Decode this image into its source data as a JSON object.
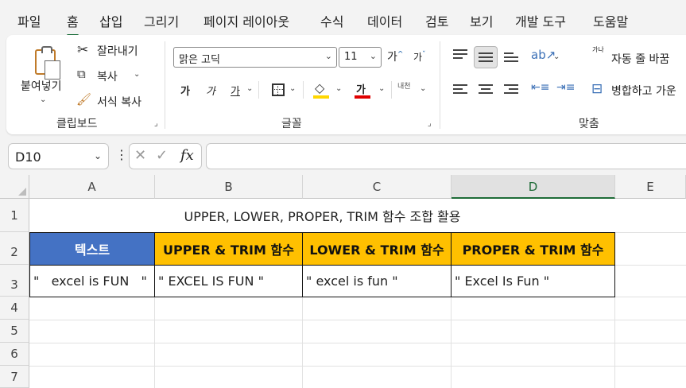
{
  "menu": {
    "tabs": [
      "파일",
      "홈",
      "삽입",
      "그리기",
      "페이지 레이아웃",
      "수식",
      "데이터",
      "검토",
      "보기",
      "개발 도구",
      "도움말"
    ],
    "active_tab": "홈"
  },
  "ribbon": {
    "clipboard": {
      "paste_label": "붙여넣기",
      "cut_label": "잘라내기",
      "copy_label": "복사",
      "format_painter_label": "서식 복사",
      "group_label": "클립보드"
    },
    "font": {
      "font_name": "맑은 고딕",
      "font_size": "11",
      "grow_label": "가",
      "shrink_label": "가",
      "bold_label": "가",
      "italic_label": "가",
      "underline_label": "가",
      "font_color_label": "가",
      "phonetic_label": "내천",
      "group_label": "글꼴"
    },
    "alignment": {
      "wrap_text_label": "자동 줄 바꿈",
      "merge_label": "병합하고 가운",
      "orientation_label": "가나",
      "group_label": "맞춤"
    }
  },
  "formula_bar": {
    "name_box": "D10",
    "fx_label": "fx",
    "formula": ""
  },
  "sheet": {
    "columns": [
      "A",
      "B",
      "C",
      "D",
      "E"
    ],
    "selected_column": "D",
    "rows": [
      "1",
      "2",
      "3",
      "4",
      "5",
      "6",
      "7"
    ],
    "title": "UPPER, LOWER, PROPER, TRIM 함수 조합 활용",
    "headers": [
      "텍스트",
      "UPPER & TRIM 함수",
      "LOWER & TRIM 함수",
      "PROPER & TRIM 함수"
    ],
    "data_row": [
      "\"   excel is FUN   \"",
      "\" EXCEL IS FUN \"",
      "\" excel is fun \"",
      "\" Excel Is Fun \""
    ]
  },
  "colors": {
    "header_blue": "#4472c4",
    "header_gold": "#ffc000",
    "accent_green": "#1e6b37",
    "fill_yellow": "#ffd700"
  }
}
